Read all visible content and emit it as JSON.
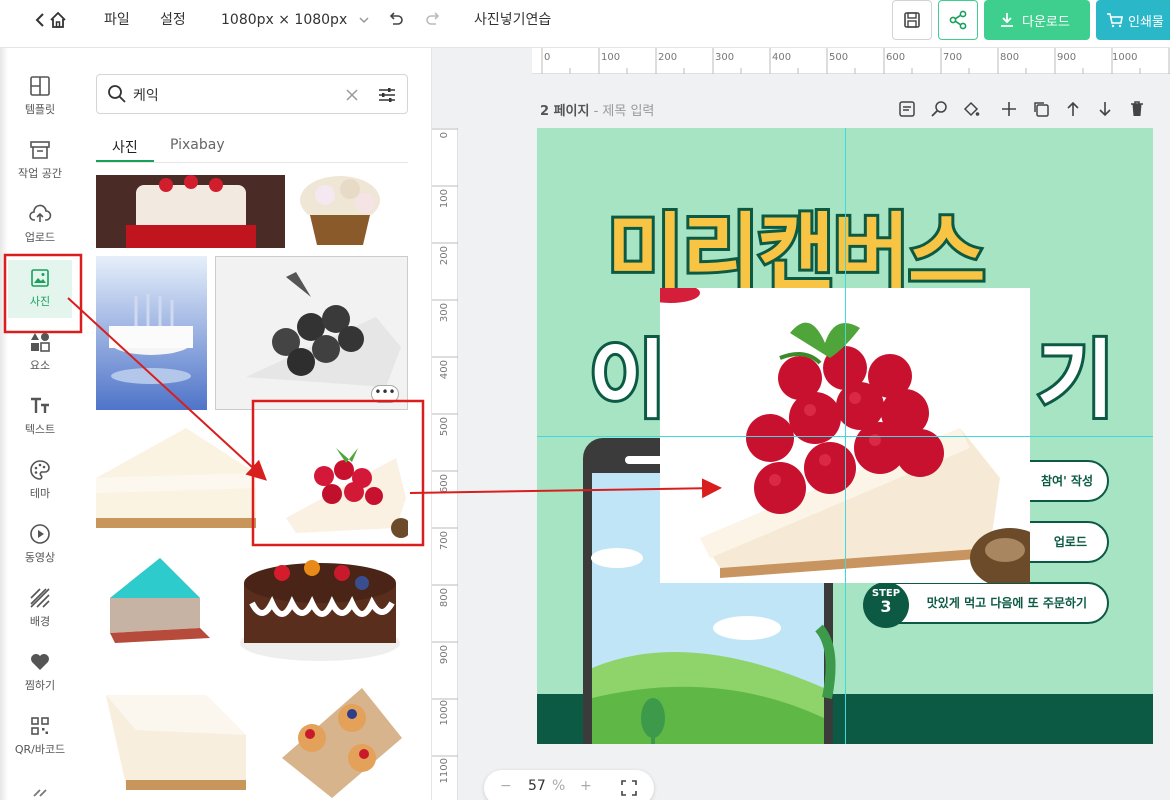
{
  "topbar": {
    "menu": [
      "파일",
      "설정"
    ],
    "canvas_size": "1080px × 1080px",
    "doc_title": "사진넣기연습",
    "download_label": "다운로드",
    "print_label": "인쇄물"
  },
  "rail": {
    "items": [
      "템플릿",
      "작업 공간",
      "업로드",
      "사진",
      "요소",
      "텍스트",
      "테마",
      "동영상",
      "배경",
      "찜하기",
      "QR/바코드"
    ]
  },
  "panel": {
    "search_value": "케익",
    "tabs": [
      "사진",
      "Pixabay"
    ]
  },
  "workspace": {
    "page_label": "2 페이지",
    "page_title_placeholder": "제목 입력",
    "ruler_top": [
      "0",
      "100",
      "200",
      "300",
      "400",
      "500",
      "600",
      "700",
      "800",
      "900",
      "1000"
    ],
    "ruler_left": [
      "0",
      "100",
      "200",
      "300",
      "400",
      "500",
      "600",
      "700",
      "800",
      "900",
      "1000",
      "1100"
    ],
    "zoom_value": "57",
    "zoom_unit": "%"
  },
  "canvas": {
    "headline": "미리캔버스",
    "headline2_left": "이",
    "headline2_right": "기",
    "step1": "참여' 작성",
    "step2": "업로드",
    "step3_badge_label": "STEP",
    "step3_badge_num": "3",
    "step3": "맛있게 먹고 다음에 또 주문하기"
  },
  "colors": {
    "canvas_bg": "#a7e4c4",
    "dark_green": "#0c5a44",
    "headline_fill": "#f8c443",
    "accent_green": "#1a9f5d",
    "download_btn": "#3ecf8e",
    "print_btn": "#2ab8c8",
    "annotation_red": "#d91e1e"
  }
}
